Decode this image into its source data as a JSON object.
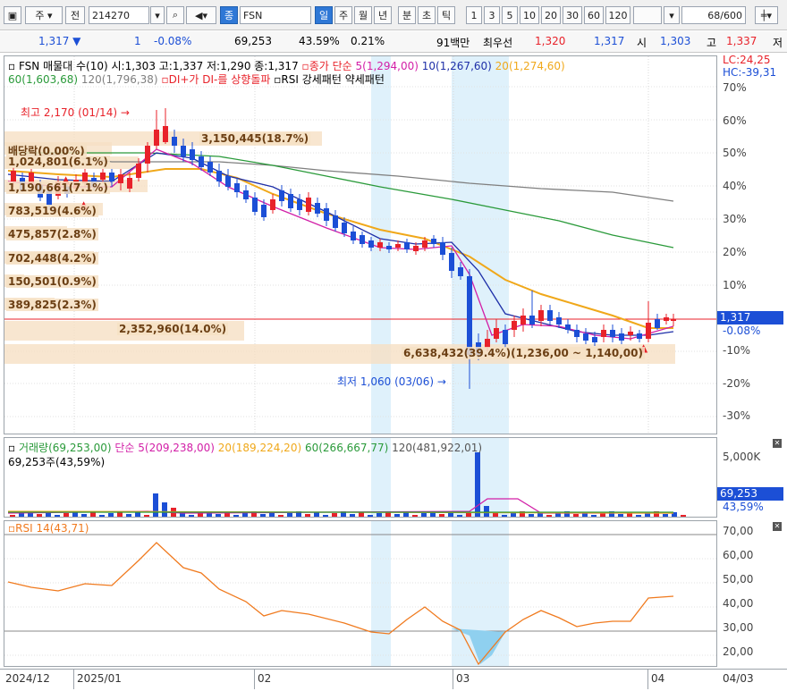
{
  "toolbar": {
    "market": "주",
    "prev_btn": "전",
    "code": "214270",
    "name_prefix": "종",
    "name": "FSN",
    "periods": [
      "일",
      "주",
      "월",
      "년",
      "분",
      "초",
      "틱"
    ],
    "active_period": "일",
    "ranges": [
      "1",
      "3",
      "5",
      "10",
      "20",
      "30",
      "60",
      "120"
    ],
    "count": "68",
    "count_total": "/600"
  },
  "quote": {
    "price": "1,317",
    "change": "1",
    "rate": "-0.08%",
    "volume": "69,253",
    "vol_ratio": "43.59%",
    "turnover": "0.21%",
    "amount": "91백만",
    "best_label": "최우선",
    "ask": "1,320",
    "bid": "1,317",
    "open_label": "시",
    "open": "1,303",
    "high_label": "고",
    "high": "1,337",
    "low_label": "저"
  },
  "price_legend": {
    "line1_name": "FSN 매물대 수(10)",
    "line1_ohlc": "시:1,303 고:1,337 저:1,290 종:1,317",
    "ma_label": "종가 단순",
    "ma5": "5(1,294,00)",
    "ma10": "10(1,267,60)",
    "ma20": "20(1,274,60)",
    "ma60": "60(1,603,68)",
    "ma120": "120(1,796,38)",
    "signal1": "DI+가 DI-를 상향돌파",
    "signal2": "RSI 강세패턴",
    "signal3": "약세패턴",
    "lc": "LC:24,25",
    "hc": "HC:-39,31"
  },
  "price_axis": [
    "70%",
    "60%",
    "50%",
    "40%",
    "30%",
    "20%",
    "10%",
    "-10%",
    "-20%",
    "-30%"
  ],
  "price_tag": {
    "value": "1,317",
    "pct": "-0.08%"
  },
  "volume_profile": [
    {
      "label": "배당락(0.00%)"
    },
    {
      "label": "1,024,801(6.1%)"
    },
    {
      "label": "1,190,661(7.1%)"
    },
    {
      "label": "783,519(4.6%)"
    },
    {
      "label": "475,857(2.8%)"
    },
    {
      "label": "702,448(4.2%)"
    },
    {
      "label": "150,501(0.9%)"
    },
    {
      "label": "389,825(2.3%)"
    },
    {
      "label": "2,352,960(14.0%)"
    },
    {
      "label": "6,638,432(39.4%)(1,236,00 ~ 1,140,00)"
    },
    {
      "label": "3,150,445(18.7%)"
    }
  ],
  "annotations": {
    "high": "최고 2,170 (01/14)",
    "low": "최저 1,060 (03/06)"
  },
  "volume_legend": {
    "name": "거래량(69,253,00)",
    "ma5": "단순 5(209,238,00)",
    "ma20": "20(189,224,20)",
    "ma60": "60(266,667,77)",
    "ma120": "120(481,922,01)",
    "sub": "69,253주(43,59%)",
    "axis_top": "5,000K",
    "tag_value": "69,253",
    "tag_pct": "43,59%"
  },
  "rsi_legend": {
    "name": "RSI 14(43,71)"
  },
  "rsi_axis": [
    "70,00",
    "60,00",
    "50,00",
    "40,00",
    "30,00",
    "20,00"
  ],
  "x_axis": [
    "2024/12",
    "2025/01",
    "02",
    "03",
    "04",
    "04/03"
  ],
  "colors": {
    "up": "#e8222a",
    "down": "#1c4fd6",
    "ma5": "#d21fa7",
    "ma10": "#1e2fa8",
    "ma20": "#f0a81a",
    "ma60": "#2a9a3a",
    "ma120": "#7f7f7f",
    "rsi": "#f07a1e",
    "highlight": "#dff1fb"
  }
}
